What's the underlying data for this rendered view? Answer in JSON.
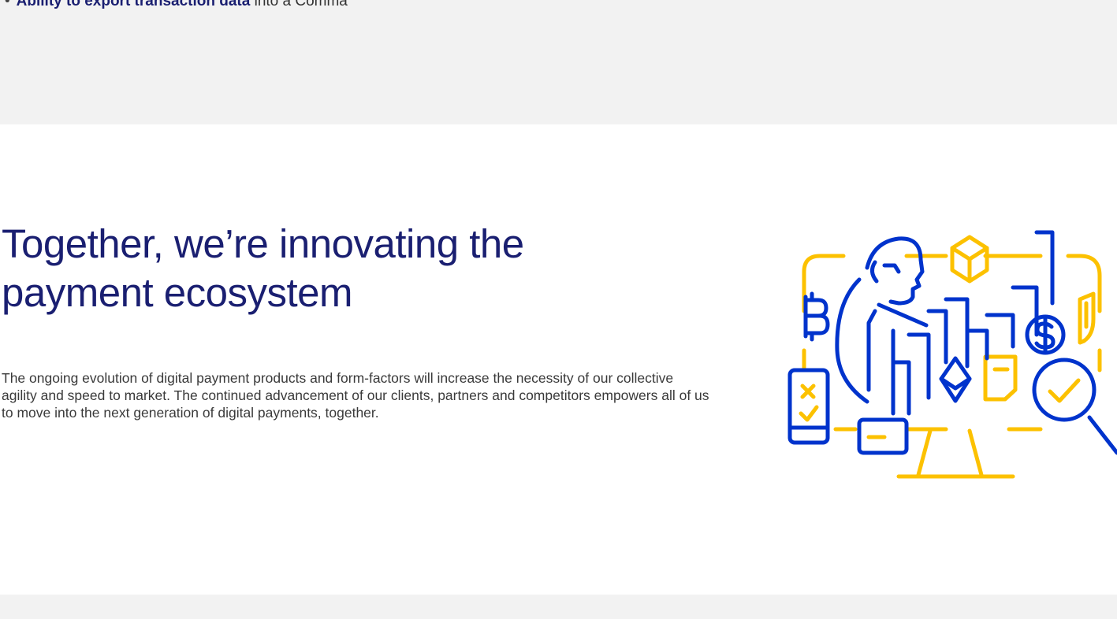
{
  "top_section": {
    "bullet": "•",
    "bold_text": "Ability to export transaction data",
    "rest_text": "into a Comma"
  },
  "hero": {
    "title": "Together, we’re innovating the payment ecosystem",
    "body": "The ongoing evolution of digital payment products and form-factors will increase the necessity of our collective agility and speed to market. The continued advancement of our clients, partners and competitors empowers all of us to move into the next generation of digital payments, together."
  },
  "illustration": {
    "name": "digital-payments-ecosystem-illustration",
    "colors": {
      "blue": "#0033cc",
      "yellow": "#fcc100"
    },
    "icons": [
      "person-icon",
      "bitcoin-icon",
      "cube-icon",
      "chart-bars-icon",
      "dollar-coin-icon",
      "shield-icon",
      "phone-icon",
      "ethereum-icon",
      "document-icon",
      "magnifier-check-icon",
      "card-icon",
      "monitor-stand-icon"
    ]
  }
}
